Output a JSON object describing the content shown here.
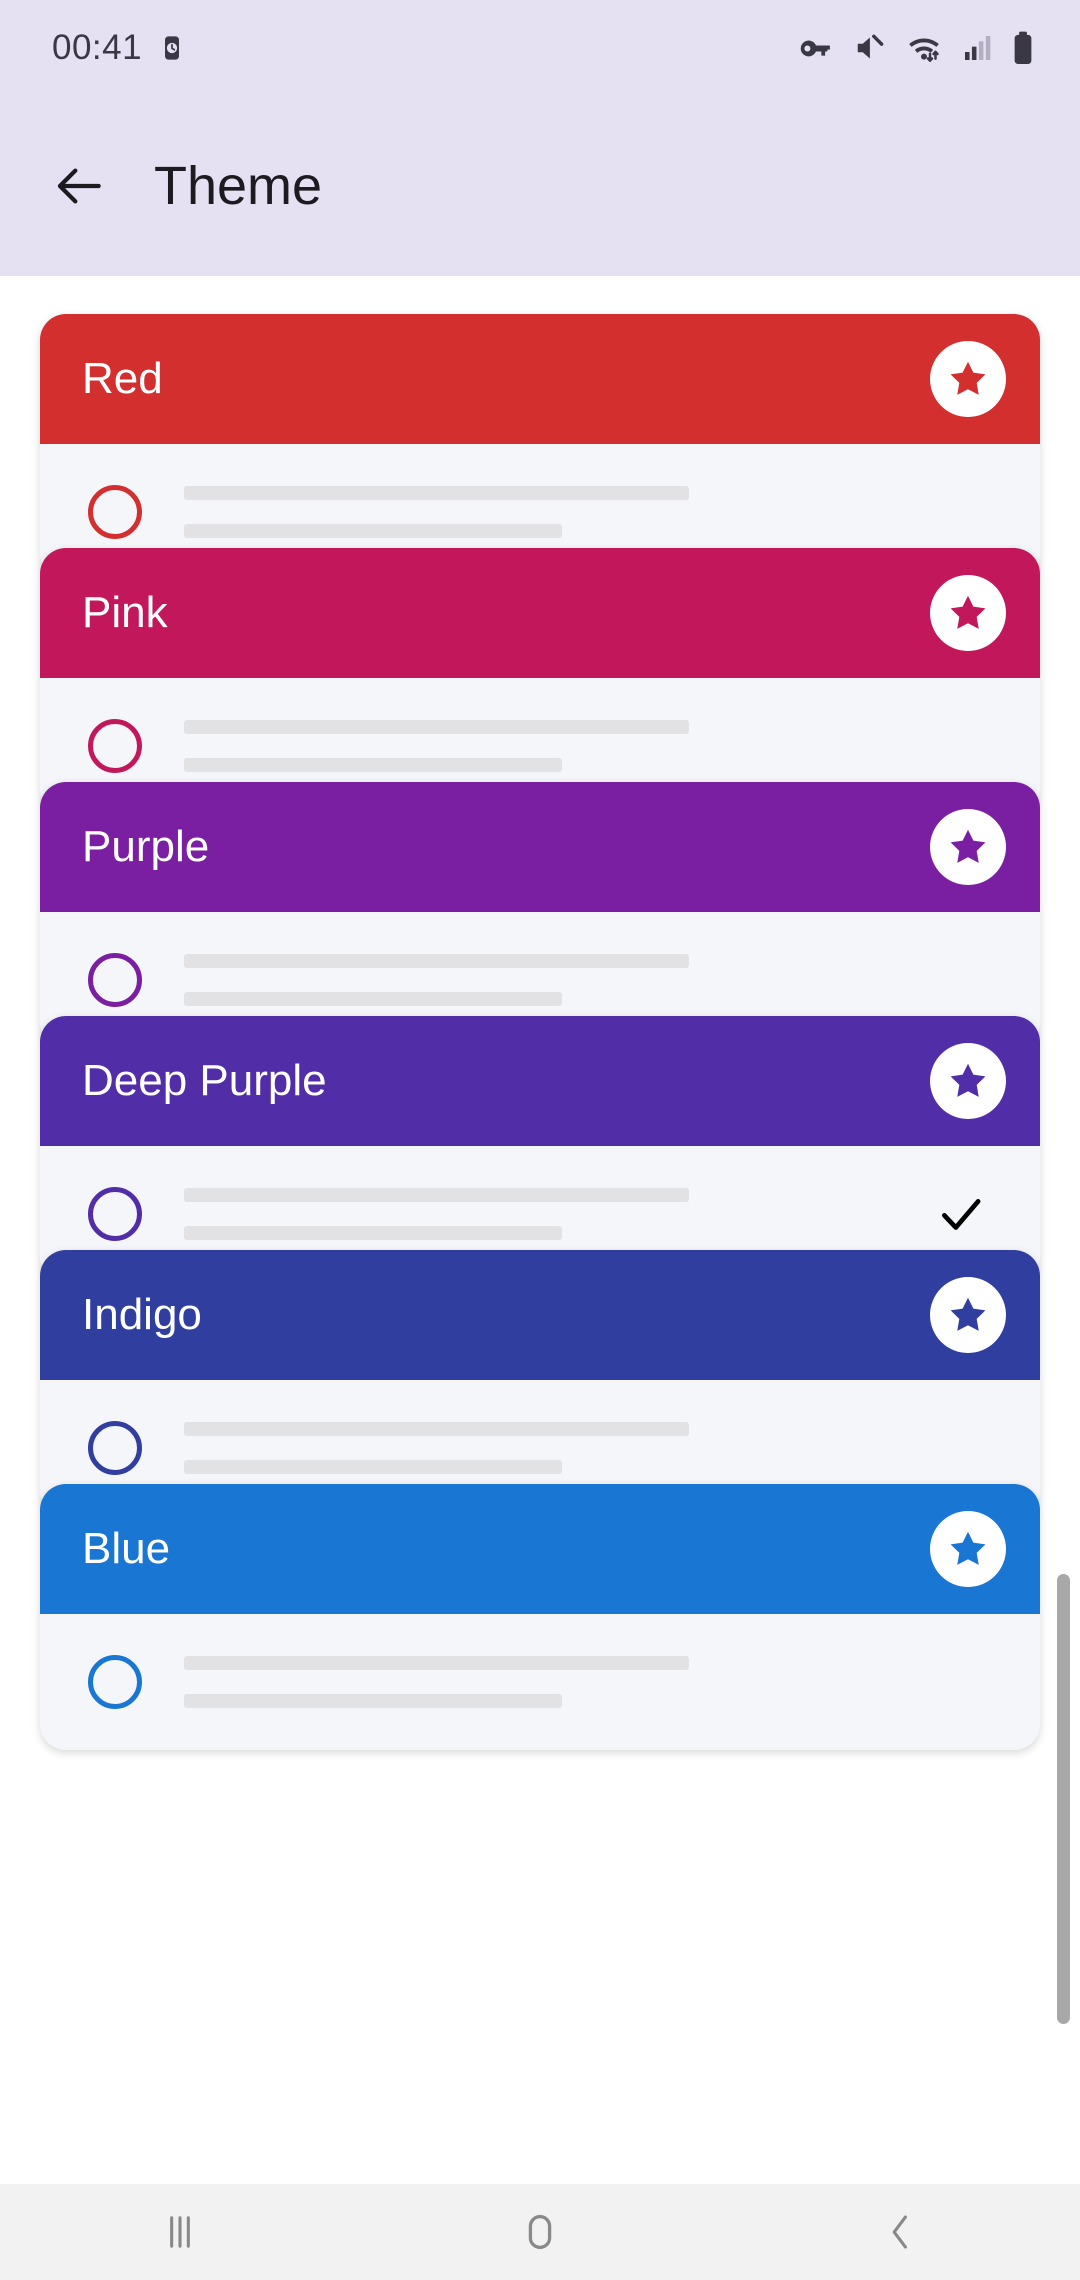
{
  "status_bar": {
    "time": "00:41",
    "icons": [
      {
        "name": "alarm-icon"
      },
      {
        "name": "vpn-key-icon"
      },
      {
        "name": "mute-icon"
      },
      {
        "name": "wifi-icon"
      },
      {
        "name": "cellular-signal-icon"
      },
      {
        "name": "battery-icon"
      }
    ]
  },
  "app_bar": {
    "back_label": "Back",
    "title": "Theme"
  },
  "colors": {
    "app_bar_bg": "#E6E0F3",
    "page_bg": "#FFFFFF",
    "card_body_bg": "#F5F6FA",
    "placeholder_line": "#E2E2E4",
    "nav_bar_bg": "#F2F2F2",
    "scrollbar_thumb": "#A8A8A8"
  },
  "themes": [
    {
      "name": "Red",
      "color": "#D32F2F",
      "favorite": true,
      "selected": false,
      "star_icon": "star-icon",
      "radio_icon": "radio-unchecked-icon"
    },
    {
      "name": "Pink",
      "color": "#C2185B",
      "favorite": true,
      "selected": false,
      "star_icon": "star-icon",
      "radio_icon": "radio-unchecked-icon"
    },
    {
      "name": "Purple",
      "color": "#7B1FA2",
      "favorite": true,
      "selected": false,
      "star_icon": "star-icon",
      "radio_icon": "radio-unchecked-icon"
    },
    {
      "name": "Deep Purple",
      "color": "#512DA8",
      "favorite": true,
      "selected": true,
      "star_icon": "star-icon",
      "radio_icon": "radio-unchecked-icon",
      "check_icon": "check-icon"
    },
    {
      "name": "Indigo",
      "color": "#303F9F",
      "favorite": true,
      "selected": false,
      "star_icon": "star-icon",
      "radio_icon": "radio-unchecked-icon"
    },
    {
      "name": "Blue",
      "color": "#1976D2",
      "favorite": true,
      "selected": false,
      "star_icon": "star-icon",
      "radio_icon": "radio-unchecked-icon"
    }
  ],
  "nav_bar": {
    "buttons": [
      {
        "name": "recents-button",
        "icon": "recents-icon"
      },
      {
        "name": "home-button",
        "icon": "home-icon"
      },
      {
        "name": "back-button",
        "icon": "chevron-left-icon"
      }
    ]
  }
}
